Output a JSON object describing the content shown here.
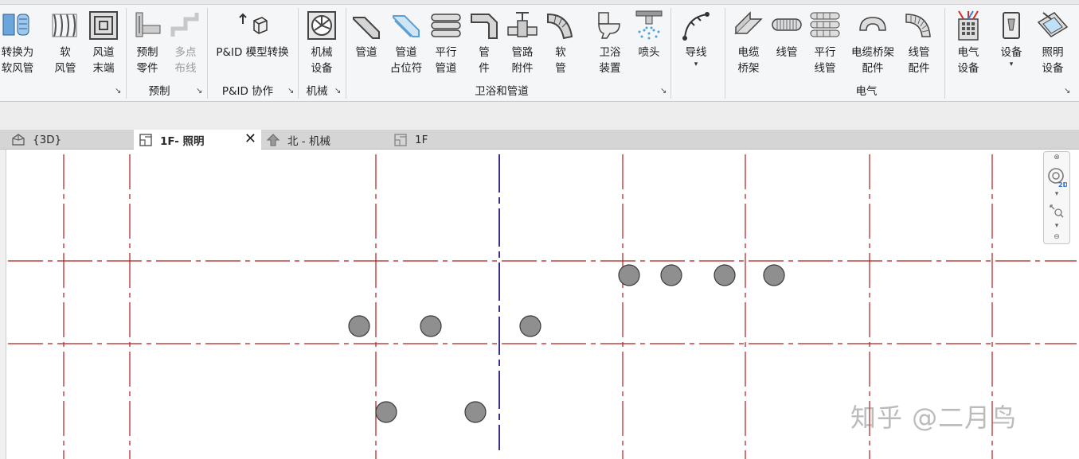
{
  "ribbon": {
    "buttons": [
      {
        "id": "convert-flex",
        "label": "转换为\n软风管",
        "icon": "convert-flex-duct-icon",
        "disabled": false
      },
      {
        "id": "flex-duct",
        "label": "软\n风管",
        "icon": "flex-duct-icon",
        "disabled": false
      },
      {
        "id": "air-terminal",
        "label": "风道\n末端",
        "icon": "air-terminal-icon",
        "disabled": false
      },
      {
        "id": "fab-part",
        "label": "预制\n零件",
        "icon": "fabrication-part-icon",
        "disabled": false
      },
      {
        "id": "multipoint",
        "label": "多点\n布线",
        "icon": "multipoint-routing-icon",
        "disabled": true
      },
      {
        "id": "pid-convert",
        "label": "P&ID 模型转换",
        "icon": "pid-model-convert-icon",
        "disabled": false
      },
      {
        "id": "mech-equip",
        "label": "机械\n设备",
        "icon": "mechanical-equipment-icon",
        "disabled": false
      },
      {
        "id": "pipe",
        "label": "管道",
        "icon": "pipe-icon",
        "disabled": false
      },
      {
        "id": "pipe-placeholder",
        "label": "管道\n占位符",
        "icon": "pipe-placeholder-icon",
        "disabled": false
      },
      {
        "id": "parallel-pipes",
        "label": "平行\n管道",
        "icon": "parallel-pipes-icon",
        "disabled": false
      },
      {
        "id": "pipe-fitting",
        "label": "管\n件",
        "icon": "pipe-fitting-icon",
        "disabled": false
      },
      {
        "id": "pipe-accessory",
        "label": "管路\n附件",
        "icon": "pipe-accessory-icon",
        "disabled": false
      },
      {
        "id": "flex-pipe",
        "label": "软\n管",
        "icon": "flex-pipe-icon",
        "disabled": false
      },
      {
        "id": "plumbing-fixture",
        "label": "卫浴\n装置",
        "icon": "plumbing-fixture-icon",
        "disabled": false
      },
      {
        "id": "sprinkler",
        "label": "喷头",
        "icon": "sprinkler-icon",
        "disabled": false
      },
      {
        "id": "wire",
        "label": "导线",
        "icon": "wire-icon",
        "disabled": false
      },
      {
        "id": "cable-tray",
        "label": "电缆\n桥架",
        "icon": "cable-tray-icon",
        "disabled": false
      },
      {
        "id": "conduit",
        "label": "线管",
        "icon": "conduit-icon",
        "disabled": false
      },
      {
        "id": "parallel-conduits",
        "label": "平行\n线管",
        "icon": "parallel-conduits-icon",
        "disabled": false
      },
      {
        "id": "cable-tray-fitting",
        "label": "电缆桥架\n配件",
        "icon": "cable-tray-fitting-icon",
        "disabled": false
      },
      {
        "id": "conduit-fitting",
        "label": "线管\n配件",
        "icon": "conduit-fitting-icon",
        "disabled": false
      },
      {
        "id": "electrical-equipment",
        "label": "电气\n设备",
        "icon": "electrical-equipment-icon",
        "disabled": false
      },
      {
        "id": "device",
        "label": "设备",
        "icon": "device-icon",
        "disabled": false
      },
      {
        "id": "lighting-fixture",
        "label": "照明\n设备",
        "icon": "lighting-fixture-icon",
        "disabled": false
      }
    ],
    "panels": [
      {
        "id": "fabrication",
        "title": "预制"
      },
      {
        "id": "pid",
        "title": "P&ID 协作"
      },
      {
        "id": "mechanical",
        "title": "机械"
      },
      {
        "id": "plumbing",
        "title": "卫浴和管道"
      },
      {
        "id": "electrical",
        "title": "电气"
      }
    ],
    "launcher_glyph": "↘",
    "dropdown_glyph": "▾"
  },
  "view_tabs": [
    {
      "id": "3d",
      "label": "{3D}",
      "icon": "3d-view-icon",
      "active": false
    },
    {
      "id": "1f-lighting",
      "label": "1F- 照明",
      "icon": "floor-plan-icon",
      "active": true,
      "close": "✕"
    },
    {
      "id": "north-mech",
      "label": "北 - 机械",
      "icon": "elevation-icon",
      "active": false
    },
    {
      "id": "1f",
      "label": "1F",
      "icon": "floor-plan-icon",
      "active": false
    }
  ],
  "navbar": {
    "wheel_badge": "2D",
    "items": [
      "steering-wheel-icon",
      "zoom-region-icon"
    ]
  },
  "colors": {
    "grid_line": "#b01c1c",
    "section_line": "#3b2f8a",
    "fixture_fill": "#8f8f8f",
    "fixture_stroke": "#3a3a3a",
    "ribbon_bg": "#f5f6f7"
  },
  "canvas": {
    "fixtures_count_label": "",
    "watermark": "知乎 @二月鸟"
  }
}
